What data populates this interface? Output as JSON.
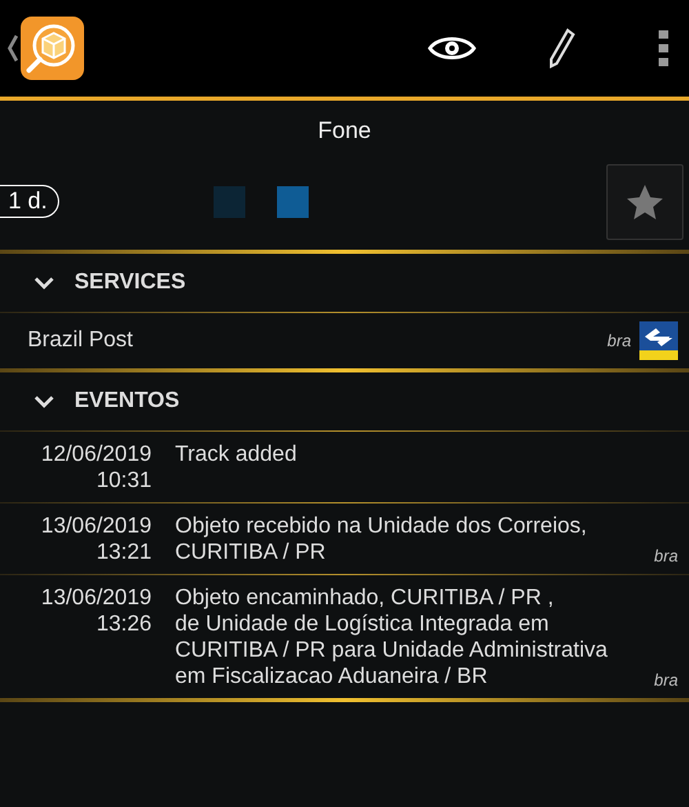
{
  "title": "Fone",
  "age_badge": "1 d.",
  "pages": [
    {
      "selected": false
    },
    {
      "selected": true
    }
  ],
  "favorite": {
    "on": false
  },
  "sections": [
    {
      "title": "SERVICES",
      "expanded": true
    },
    {
      "title": "EVENTOS",
      "expanded": true
    }
  ],
  "services": [
    {
      "name": "Brazil Post",
      "country": "bra"
    }
  ],
  "events": [
    {
      "date": "12/06/2019",
      "time": "10:31",
      "lines": [
        "Track added"
      ]
    },
    {
      "date": "13/06/2019",
      "time": "13:21",
      "lines": [
        "Objeto recebido na Unidade dos Correios,",
        "CURITIBA / PR"
      ],
      "source": "bra"
    },
    {
      "date": "13/06/2019",
      "time": "13:26",
      "lines": [
        "Objeto encaminhado, CURITIBA / PR ,",
        "de Unidade de Logística Integrada em",
        "CURITIBA / PR para Unidade Administrativa",
        "em Fiscalizacao Aduaneira / BR"
      ],
      "source": "bra"
    }
  ]
}
